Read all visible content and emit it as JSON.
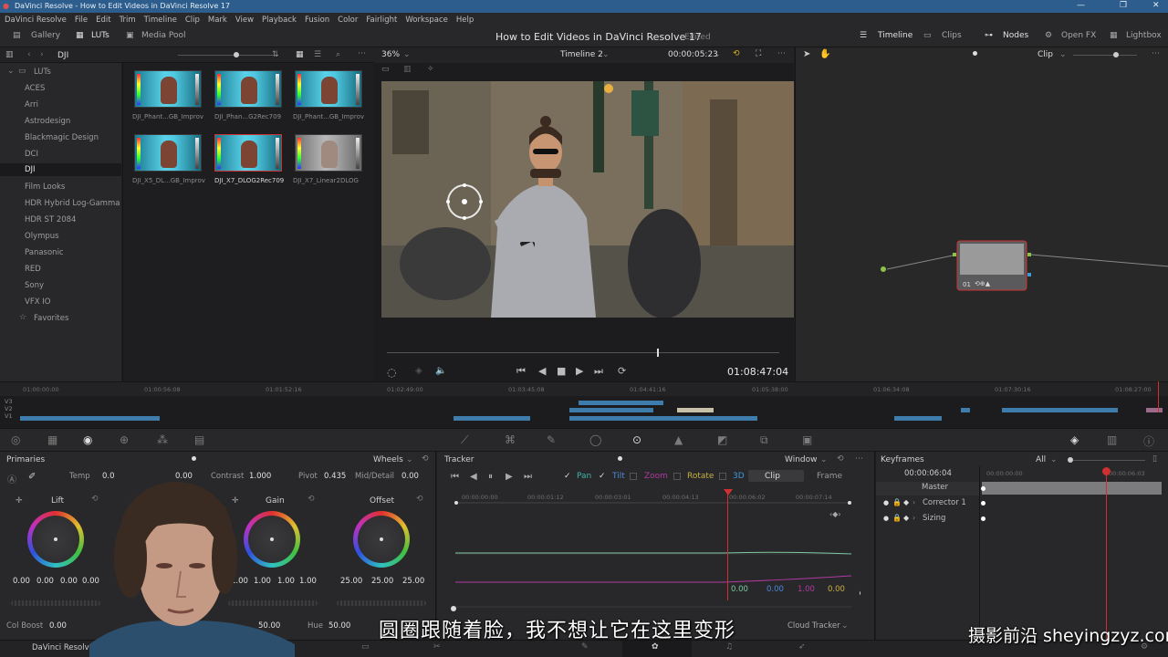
{
  "window": {
    "title": "DaVinci Resolve - How to Edit Videos in DaVinci Resolve 17"
  },
  "menu": [
    "DaVinci Resolve",
    "File",
    "Edit",
    "Trim",
    "Timeline",
    "Clip",
    "Mark",
    "View",
    "Playback",
    "Fusion",
    "Color",
    "Fairlight",
    "Workspace",
    "Help"
  ],
  "toolbar": {
    "gallery": "Gallery",
    "luts": "LUTs",
    "media_pool": "Media Pool",
    "project_title": "How to Edit Videos in DaVinci Resolve 17",
    "edited": "Edited",
    "timeline": "Timeline",
    "clips": "Clips",
    "nodes": "Nodes",
    "open_fx": "Open FX",
    "lightbox": "Lightbox"
  },
  "lut_browser": {
    "folder": "DJI",
    "root": "LUTs",
    "items": [
      "ACES",
      "Arri",
      "Astrodesign",
      "Blackmagic Design",
      "DCI",
      "DJI",
      "Film Looks",
      "HDR Hybrid Log-Gamma",
      "HDR ST 2084",
      "Olympus",
      "Panasonic",
      "RED",
      "Sony",
      "VFX IO",
      "Favorites"
    ],
    "selected": "DJI",
    "thumbnails": [
      "DJI_Phant...GB_Improv",
      "DJI_Phan...G2Rec709",
      "DJI_Phant...GB_Improv",
      "DJI_X5_DL...GB_Improv",
      "DJI_X7_DLOG2Rec709",
      "DJI_X7_Linear2DLOG"
    ],
    "selected_thumb": "DJI_X7_DLOG2Rec709"
  },
  "viewer": {
    "zoom": "36%",
    "timeline_name": "Timeline 2",
    "source_tc": "00:00:05:23",
    "record_tc": "01:08:47:04"
  },
  "node_editor": {
    "mode": "Clip",
    "node_label": "01"
  },
  "ruler_ticks": [
    "01:00:00:00",
    "01:00:56:08",
    "01:01:52:16",
    "01:02:49:00",
    "01:03:45:08",
    "01:04:41:16",
    "01:05:38:00",
    "01:06:34:08",
    "01:07:30:16",
    "01:08:27:00"
  ],
  "tracks": [
    "V3",
    "V2",
    "V1"
  ],
  "primaries": {
    "title": "Primaries",
    "mode": "Wheels",
    "temp_label": "Temp",
    "temp": "0.0",
    "tint": "0.00",
    "contrast_label": "Contrast",
    "contrast": "1.000",
    "pivot_label": "Pivot",
    "pivot": "0.435",
    "middetail_label": "Mid/Detail",
    "middetail": "0.00",
    "lift": {
      "label": "Lift",
      "values": [
        "0.00",
        "0.00",
        "0.00",
        "0.00"
      ]
    },
    "gain": {
      "label": "Gain",
      "values": [
        "1.00",
        "1.00",
        "1.00",
        "1.00"
      ]
    },
    "offset": {
      "label": "Offset",
      "values": [
        "25.00",
        "25.00",
        "25.00"
      ]
    },
    "col_boost_label": "Col Boost",
    "col_boost": "0.00",
    "sat": "50.00",
    "hue_label": "Hue",
    "hue": "50.00"
  },
  "tracker": {
    "title": "Tracker",
    "mode": "Window",
    "pan": "Pan",
    "tilt": "Tilt",
    "zoom": "Zoom",
    "rotate": "Rotate",
    "three_d": "3D",
    "clip_tab": "Clip",
    "frame_tab": "Frame",
    "ticks": [
      "00:00:00:00",
      "00:00:01:12",
      "00:00:03:01",
      "00:00:04:13",
      "00:00:06:02",
      "00:00:07:14"
    ],
    "readout": [
      "0.00",
      "0.00",
      "1.00",
      "0.00"
    ],
    "cloud_tracker": "Cloud Tracker"
  },
  "keyframes": {
    "title": "Keyframes",
    "filter": "All",
    "timecode": "00:00:06:04",
    "tc_start": "00:00:00:00",
    "tc_end": "00:00:06:03",
    "rows": [
      "Master",
      "Corrector 1",
      "Sizing"
    ]
  },
  "subtitle": "圆圈跟随着脸，我不想让它在这里变形",
  "watermark": "摄影前沿 sheyingzyz.com",
  "bottom": {
    "app": "DaVinci Resolve"
  },
  "colors": {
    "accent": "#2c5d8c",
    "track_clip": "#3d7cab",
    "playhead": "#d03030",
    "selected_border": "#cc3333"
  }
}
